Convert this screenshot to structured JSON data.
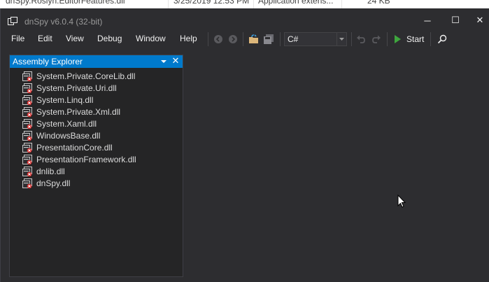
{
  "background": {
    "filename": "dnSpy.Roslyn.EditorFeatures.dll",
    "date": "3/25/2019 12:53 PM",
    "type": "Application extens...",
    "size": "24 KB"
  },
  "window": {
    "title": "dnSpy v6.0.4 (32-bit)",
    "controls": {
      "minimize": "─",
      "maximize": "☐",
      "close": "✕"
    }
  },
  "menu": {
    "items": [
      "File",
      "Edit",
      "View",
      "Debug",
      "Window",
      "Help"
    ]
  },
  "toolbar": {
    "language": "C#",
    "start_label": "Start"
  },
  "explorer": {
    "title": "Assembly Explorer",
    "close_glyph": "✕",
    "assemblies": [
      "System.Private.CoreLib.dll",
      "System.Private.Uri.dll",
      "System.Linq.dll",
      "System.Private.Xml.dll",
      "System.Xaml.dll",
      "WindowsBase.dll",
      "PresentationCore.dll",
      "PresentationFramework.dll",
      "dnlib.dll",
      "dnSpy.dll"
    ]
  },
  "colors": {
    "background": "#2d2d30",
    "panel": "#252526",
    "accent": "#007acc",
    "start_green": "#3ea63e",
    "text": "#f1f1f1"
  },
  "icons": {
    "app": "dnspy-app-icon",
    "back": "nav-back-icon",
    "forward": "nav-forward-icon",
    "open": "open-folder-icon",
    "save": "save-all-icon",
    "undo": "undo-icon",
    "redo": "redo-icon",
    "start": "play-icon",
    "search": "search-icon",
    "assembly": "assembly-icon"
  }
}
